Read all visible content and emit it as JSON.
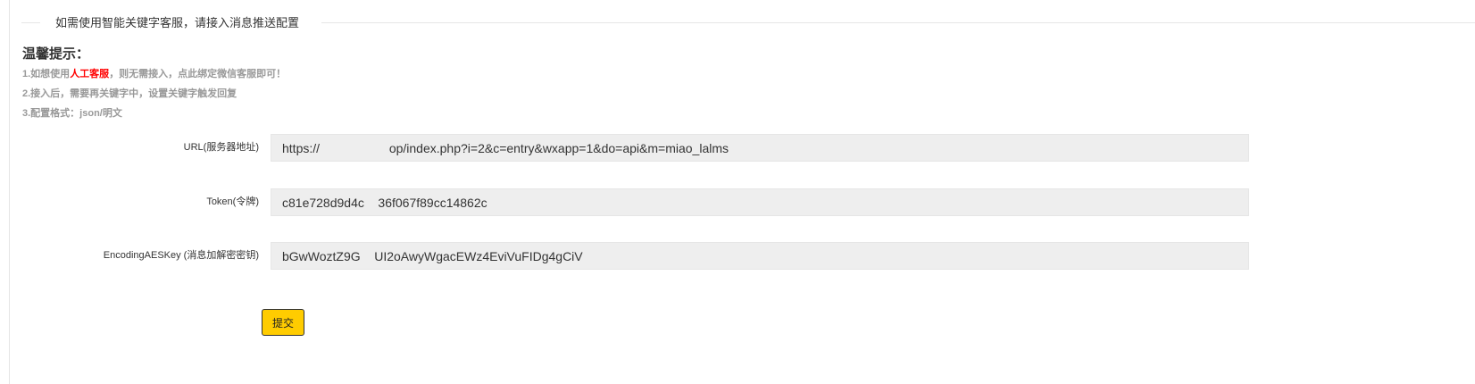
{
  "section": {
    "legend": "如需使用智能关键字客服，请接入消息推送配置"
  },
  "tips": {
    "title": "温馨提示：",
    "line1_before": "1.如想使用",
    "line1_highlight": "人工客服",
    "line1_after": "，则无需接入，点此绑定微信客服即可！",
    "line2": "2.接入后，需要再关键字中，设置关键字触发回复",
    "line3": "3.配置格式：json/明文"
  },
  "form": {
    "url_label": "URL(服务器地址)",
    "url_value": "https://                    op/index.php?i=2&c=entry&wxapp=1&do=api&m=miao_lalms",
    "token_label": "Token(令牌)",
    "token_value": "c81e728d9d4c    36f067f89cc14862c",
    "aeskey_label": "EncodingAESKey (消息加解密密钥)",
    "aeskey_value": "bGwWoztZ9G    UI2oAwyWgacEWz4EviVuFIDg4gCiV",
    "submit_label": "提交"
  },
  "colors": {
    "highlight": "#ff0000",
    "button_bg": "#ffcc00",
    "field_bg": "#eeeeee",
    "tip_text": "#999999"
  }
}
